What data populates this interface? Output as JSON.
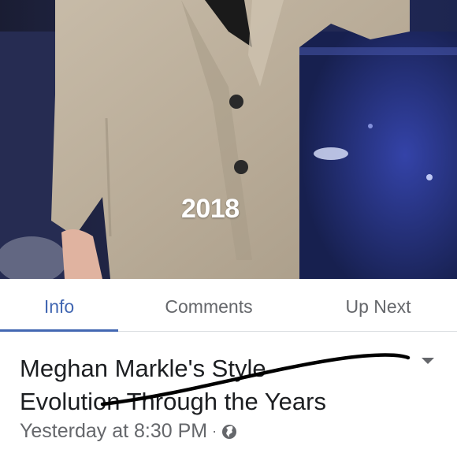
{
  "media": {
    "year_caption": "2018"
  },
  "tabs": [
    {
      "label": "Info",
      "active": true
    },
    {
      "label": "Comments",
      "active": false
    },
    {
      "label": "Up Next",
      "active": false
    }
  ],
  "post": {
    "title_line1": "Meghan Markle's Style",
    "title_line2": "Evolution Through the Years",
    "timestamp": "Yesterday at 8:30 PM",
    "separator": "·",
    "privacy_icon": "globe-icon",
    "menu_icon": "chevron-down-icon"
  },
  "colors": {
    "accent": "#4267b2",
    "text_primary": "#1c1e21",
    "text_secondary": "#65676b"
  }
}
